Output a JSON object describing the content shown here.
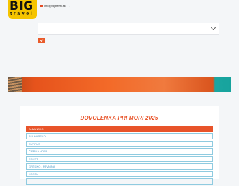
{
  "brand": {
    "big": "BIG",
    "travel": "travel"
  },
  "header": {
    "email": "info@bigtravel.sk",
    "separator": "/"
  },
  "search": {
    "dropdown_value": "",
    "go_icon": "arrow-icon"
  },
  "section": {
    "title": "DOVOLENKA PRI MORI 2025"
  },
  "destinations": [
    {
      "label": "ALBANSKO",
      "active": true
    },
    {
      "label": "BULHARSKO"
    },
    {
      "label": "CYPRUS"
    },
    {
      "label": "ČIERNA HORA"
    },
    {
      "label": "EGYPT"
    },
    {
      "label": "GRÉCKO - PEVNINA"
    },
    {
      "label": "KORFU"
    },
    {
      "label": ""
    }
  ],
  "colors": {
    "accent": "#e8542a",
    "logo": "#f5c400",
    "list_border": "#8fcbe0"
  }
}
